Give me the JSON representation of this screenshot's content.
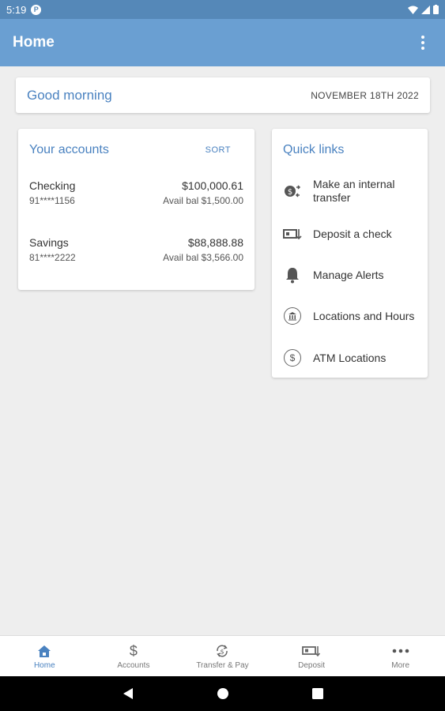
{
  "status": {
    "time": "5:19",
    "notif_glyph": "P"
  },
  "app_bar": {
    "title": "Home"
  },
  "greeting": {
    "text": "Good morning",
    "date": "NOVEMBER 18TH 2022"
  },
  "accounts": {
    "title": "Your accounts",
    "sort_label": "SORT",
    "items": [
      {
        "name": "Checking",
        "number": "91****1156",
        "balance": "$100,000.61",
        "avail": "Avail bal $1,500.00"
      },
      {
        "name": "Savings",
        "number": "81****2222",
        "balance": "$88,888.88",
        "avail": "Avail bal $3,566.00"
      }
    ]
  },
  "quick_links": {
    "title": "Quick links",
    "items": [
      {
        "label": "Make an internal transfer",
        "icon": "transfer-icon"
      },
      {
        "label": "Deposit a check",
        "icon": "check-icon"
      },
      {
        "label": "Manage Alerts",
        "icon": "bell-icon"
      },
      {
        "label": "Locations and Hours",
        "icon": "bank-icon"
      },
      {
        "label": "ATM Locations",
        "icon": "dollar-circle-icon"
      }
    ]
  },
  "bottom_nav": {
    "tabs": [
      {
        "label": "Home",
        "icon": "home-icon",
        "active": true
      },
      {
        "label": "Accounts",
        "icon": "dollar-icon",
        "active": false
      },
      {
        "label": "Transfer & Pay",
        "icon": "transfer-pay-icon",
        "active": false
      },
      {
        "label": "Deposit",
        "icon": "deposit-icon",
        "active": false
      },
      {
        "label": "More",
        "icon": "more-icon",
        "active": false
      }
    ]
  },
  "colors": {
    "primary": "#6a9fd2",
    "status_bar": "#5588b8",
    "accent_text": "#4a82c0",
    "background": "#eeeeee"
  }
}
